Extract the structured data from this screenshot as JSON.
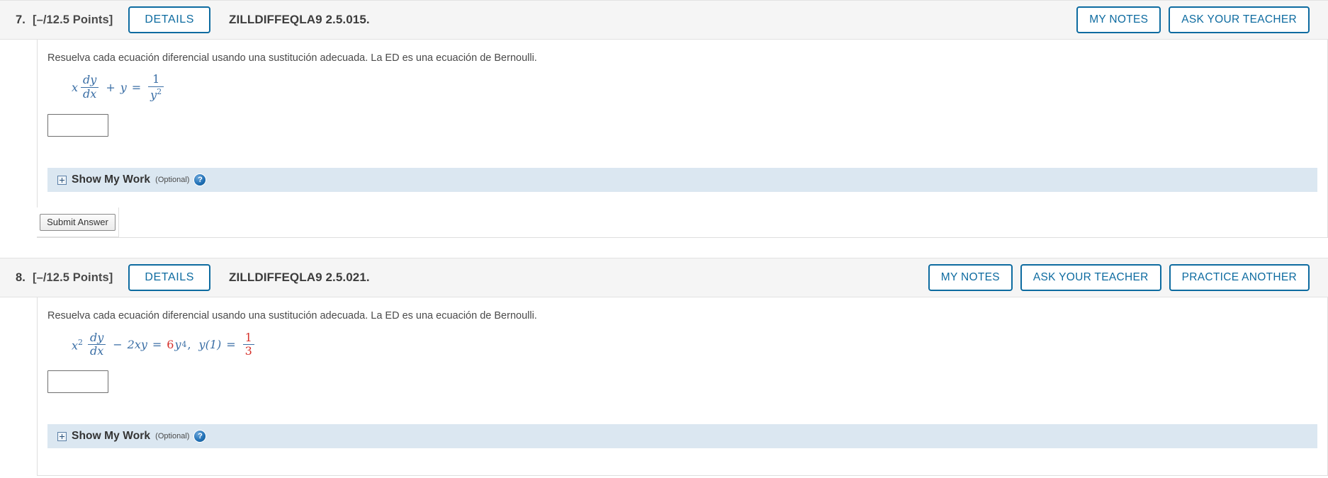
{
  "problems": [
    {
      "number": "7.",
      "points": "[–/12.5 Points]",
      "details_label": "DETAILS",
      "code": "ZILLDIFFEQLA9 2.5.015.",
      "actions": [
        "MY NOTES",
        "ASK YOUR TEACHER"
      ],
      "prompt": "Resuelva cada ecuación diferencial usando una sustitución adecuada. La ED es una ecuación de Bernoulli.",
      "equation": {
        "lhs_var": "x",
        "frac_num": "dy",
        "frac_den": "dx",
        "plus": "+",
        "term2": "y",
        "equals": "=",
        "rhs_num": "1",
        "rhs_den": "y",
        "rhs_den_exp": "2"
      },
      "answer_value": "",
      "show_my_work": {
        "label": "Show My Work",
        "optional": "(Optional)",
        "help": "?",
        "expand_icon": "plus-box-icon"
      },
      "submit_label": "Submit Answer",
      "has_submit": true
    },
    {
      "number": "8.",
      "points": "[–/12.5 Points]",
      "details_label": "DETAILS",
      "code": "ZILLDIFFEQLA9 2.5.021.",
      "actions": [
        "MY NOTES",
        "ASK YOUR TEACHER",
        "PRACTICE ANOTHER"
      ],
      "prompt": "Resuelva cada ecuación diferencial usando una sustitución adecuada. La ED es una ecuación de Bernoulli.",
      "equation": {
        "lhs_var": "x",
        "lhs_exp": "2",
        "frac_num": "dy",
        "frac_den": "dx",
        "minus": "−",
        "term2": "2xy",
        "equals": "=",
        "rhs_coef": "6",
        "rhs_var": "y",
        "rhs_exp": "4",
        "comma": ",",
        "initial": "y(1)",
        "equals2": "=",
        "init_num": "1",
        "init_den": "3"
      },
      "answer_value": "",
      "show_my_work": {
        "label": "Show My Work",
        "optional": "(Optional)",
        "help": "?",
        "expand_icon": "plus-box-icon"
      },
      "has_submit": false
    }
  ],
  "colors": {
    "accent": "#0d6ba0",
    "math": "#3a6ea5",
    "highlight": "#d6312b",
    "header_bg": "#f5f5f5",
    "smw_bg": "#dbe7f1"
  }
}
